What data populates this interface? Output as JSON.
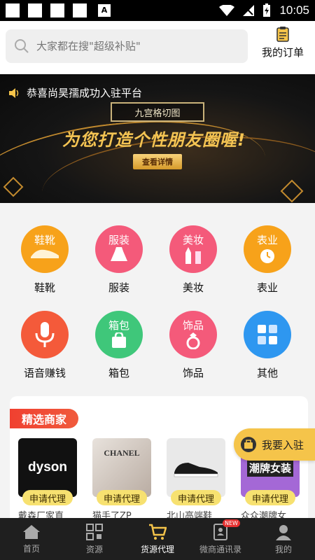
{
  "status_bar": {
    "time": "10:05",
    "app_icon_letter": "A"
  },
  "search": {
    "placeholder": "大家都在搜\"超级补贴\""
  },
  "header": {
    "orders_label": "我的订单"
  },
  "banner": {
    "notice": "恭喜尚昊孺成功入驻平台",
    "tag": "九宫格切图",
    "headline": "为您打造个性朋友圈喔!",
    "button": "查看详情"
  },
  "categories": [
    {
      "label": "鞋靴",
      "icon_text": "鞋靴",
      "color": "#f7a21a"
    },
    {
      "label": "服装",
      "icon_text": "服装",
      "color": "#f45a7a"
    },
    {
      "label": "美妆",
      "icon_text": "美妆",
      "color": "#f45a7a"
    },
    {
      "label": "表业",
      "icon_text": "表业",
      "color": "#f7a21a"
    },
    {
      "label": "语音赚钱",
      "icon_text": "",
      "color": "#f45a3a"
    },
    {
      "label": "箱包",
      "icon_text": "箱包",
      "color": "#3fc77a"
    },
    {
      "label": "饰品",
      "icon_text": "饰品",
      "color": "#f45a7a"
    },
    {
      "label": "其他",
      "icon_text": "",
      "color": "#2e97f0"
    }
  ],
  "featured": {
    "title": "精选商家",
    "merchants": [
      {
        "name": "戴森厂家直",
        "badge": "申请代理",
        "image_text": "dyson"
      },
      {
        "name": "猫手了ZP",
        "badge": "申请代理",
        "image_text": "CHANEL"
      },
      {
        "name": "北山高端鞋",
        "badge": "申请代理",
        "image_text": ""
      },
      {
        "name": "众众潮牌女",
        "badge": "申请代理",
        "image_text": "潮牌女装"
      }
    ]
  },
  "join": {
    "label": "我要入驻"
  },
  "nav": [
    {
      "label": "首页",
      "icon": "home-icon"
    },
    {
      "label": "资源",
      "icon": "qrcode-icon"
    },
    {
      "label": "货源代理",
      "icon": "cart-icon"
    },
    {
      "label": "微商通讯录",
      "icon": "contacts-icon",
      "badge": "NEW"
    },
    {
      "label": "我的",
      "icon": "user-icon"
    }
  ]
}
